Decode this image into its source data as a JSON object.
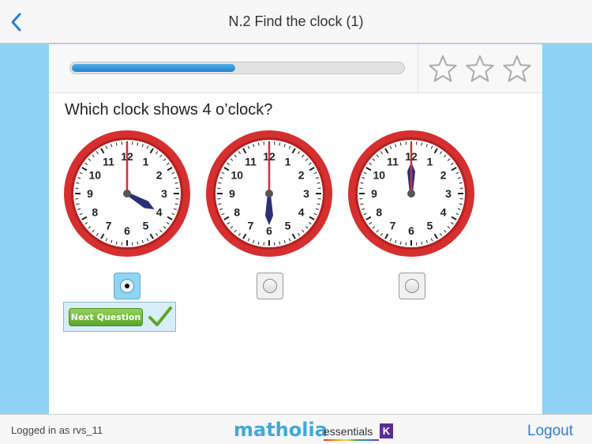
{
  "header": {
    "title": "N.2 Find the clock (1)",
    "back_icon": "chevron-left-icon"
  },
  "progress": {
    "fraction": 0.5
  },
  "stars": {
    "earned": 0,
    "total": 3
  },
  "question": {
    "text": "Which clock shows 4 o’clock?"
  },
  "clocks": [
    {
      "hour": 4,
      "minute": 0,
      "selected": true
    },
    {
      "hour": 6,
      "minute": 0,
      "selected": false
    },
    {
      "hour": 12,
      "minute": 0,
      "selected": false
    }
  ],
  "clock_numbers": [
    "1",
    "2",
    "3",
    "4",
    "5",
    "6",
    "7",
    "8",
    "9",
    "10",
    "11",
    "12"
  ],
  "next": {
    "label": "Next Question",
    "icon": "checkmark-icon"
  },
  "footer": {
    "logged_in": "Logged in as rvs_11",
    "brand": "matholia",
    "edition": "essentials",
    "badge": "K",
    "logout": "Logout"
  },
  "colors": {
    "clock_rim": "#d62f2f",
    "accent_blue": "#2b7fd0",
    "hand": "#2a2f7a",
    "second_hand": "#d62f2f"
  }
}
